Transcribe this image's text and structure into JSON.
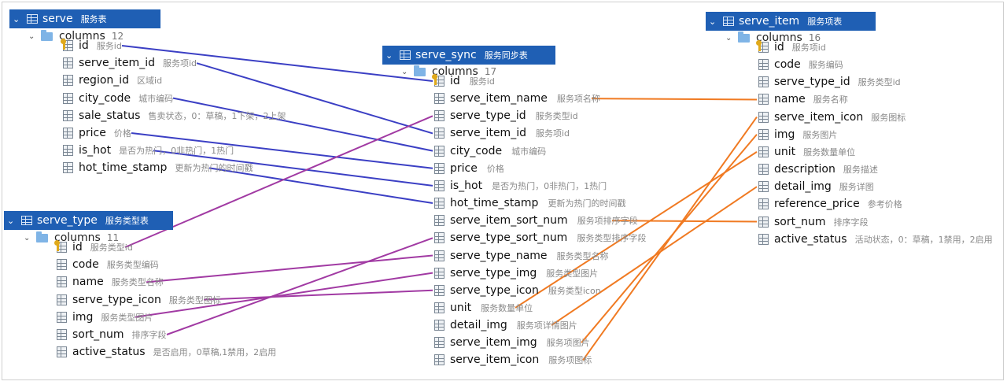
{
  "serve": {
    "name": "serve",
    "comment": "服务表",
    "columns_label": "columns",
    "column_count": "12",
    "fields": [
      {
        "name": "id",
        "comment": "服务id",
        "key": true
      },
      {
        "name": "serve_item_id",
        "comment": "服务项id"
      },
      {
        "name": "region_id",
        "comment": "区域id"
      },
      {
        "name": "city_code",
        "comment": "城市编码"
      },
      {
        "name": "sale_status",
        "comment": "售卖状态，0：草稿，1下架，2上架"
      },
      {
        "name": "price",
        "comment": "价格"
      },
      {
        "name": "is_hot",
        "comment": "是否为热门，0非热门，1热门"
      },
      {
        "name": "hot_time_stamp",
        "comment": "更新为热门的时间戳"
      }
    ]
  },
  "serve_type": {
    "name": "serve_type",
    "comment": "服务类型表",
    "columns_label": "columns",
    "column_count": "11",
    "fields": [
      {
        "name": "id",
        "comment": "服务类型id",
        "key": true
      },
      {
        "name": "code",
        "comment": "服务类型编码"
      },
      {
        "name": "name",
        "comment": "服务类型名称"
      },
      {
        "name": "serve_type_icon",
        "comment": "服务类型图标"
      },
      {
        "name": "img",
        "comment": "服务类型图片"
      },
      {
        "name": "sort_num",
        "comment": "排序字段"
      },
      {
        "name": "active_status",
        "comment": "是否启用，0草稿,1禁用，2启用"
      }
    ]
  },
  "serve_sync": {
    "name": "serve_sync",
    "comment": "服务同步表",
    "columns_label": "columns",
    "column_count": "17",
    "fields": [
      {
        "name": "id",
        "comment": "服务id",
        "key": true
      },
      {
        "name": "serve_item_name",
        "comment": "服务项名称"
      },
      {
        "name": "serve_type_id",
        "comment": "服务类型id"
      },
      {
        "name": "serve_item_id",
        "comment": "服务项id"
      },
      {
        "name": "city_code",
        "comment": "城市编码"
      },
      {
        "name": "price",
        "comment": "价格"
      },
      {
        "name": "is_hot",
        "comment": "是否为热门，0非热门，1热门"
      },
      {
        "name": "hot_time_stamp",
        "comment": "更新为热门的时间戳"
      },
      {
        "name": "serve_item_sort_num",
        "comment": "服务项排序字段"
      },
      {
        "name": "serve_type_sort_num",
        "comment": "服务类型排序字段"
      },
      {
        "name": "serve_type_name",
        "comment": "服务类型名称"
      },
      {
        "name": "serve_type_img",
        "comment": "服务类型图片"
      },
      {
        "name": "serve_type_icon",
        "comment": "服务类型icon"
      },
      {
        "name": "unit",
        "comment": "服务数量单位"
      },
      {
        "name": "detail_img",
        "comment": "服务项详情图片"
      },
      {
        "name": "serve_item_img",
        "comment": "服务项图片"
      },
      {
        "name": "serve_item_icon",
        "comment": "服务项图标"
      }
    ]
  },
  "serve_item": {
    "name": "serve_item",
    "comment": "服务项表",
    "columns_label": "columns",
    "column_count": "16",
    "fields": [
      {
        "name": "id",
        "comment": "服务项id",
        "key": true
      },
      {
        "name": "code",
        "comment": "服务编码"
      },
      {
        "name": "serve_type_id",
        "comment": "服务类型id"
      },
      {
        "name": "name",
        "comment": "服务名称"
      },
      {
        "name": "serve_item_icon",
        "comment": "服务图标"
      },
      {
        "name": "img",
        "comment": "服务图片"
      },
      {
        "name": "unit",
        "comment": "服务数量单位"
      },
      {
        "name": "description",
        "comment": "服务描述"
      },
      {
        "name": "detail_img",
        "comment": "服务详图"
      },
      {
        "name": "reference_price",
        "comment": "参考价格"
      },
      {
        "name": "sort_num",
        "comment": "排序字段"
      },
      {
        "name": "active_status",
        "comment": "活动状态，0：草稿，1禁用，2启用"
      }
    ]
  },
  "colors": {
    "header": "#1f5fb4",
    "serve_links": "#3b3fc4",
    "serve_type_links": "#a13aa3",
    "serve_item_links": "#f07a22"
  },
  "links": [
    {
      "from": "serve.id",
      "to": "serve_sync.id",
      "color": "serve_links"
    },
    {
      "from": "serve.serve_item_id",
      "to": "serve_sync.serve_item_id",
      "color": "serve_links"
    },
    {
      "from": "serve.city_code",
      "to": "serve_sync.city_code",
      "color": "serve_links"
    },
    {
      "from": "serve.price",
      "to": "serve_sync.price",
      "color": "serve_links"
    },
    {
      "from": "serve.is_hot",
      "to": "serve_sync.is_hot",
      "color": "serve_links"
    },
    {
      "from": "serve.hot_time_stamp",
      "to": "serve_sync.hot_time_stamp",
      "color": "serve_links"
    },
    {
      "from": "serve_type.id",
      "to": "serve_sync.serve_type_id",
      "color": "serve_type_links"
    },
    {
      "from": "serve_type.name",
      "to": "serve_sync.serve_type_name",
      "color": "serve_type_links"
    },
    {
      "from": "serve_type.serve_type_icon",
      "to": "serve_sync.serve_type_icon",
      "color": "serve_type_links"
    },
    {
      "from": "serve_type.img",
      "to": "serve_sync.serve_type_img",
      "color": "serve_type_links"
    },
    {
      "from": "serve_type.sort_num",
      "to": "serve_sync.serve_type_sort_num",
      "color": "serve_type_links"
    },
    {
      "from": "serve_sync.serve_item_name",
      "to": "serve_item.name",
      "color": "serve_item_links"
    },
    {
      "from": "serve_sync.serve_item_sort_num",
      "to": "serve_item.sort_num",
      "color": "serve_item_links"
    },
    {
      "from": "serve_sync.unit",
      "to": "serve_item.unit",
      "color": "serve_item_links"
    },
    {
      "from": "serve_sync.detail_img",
      "to": "serve_item.detail_img",
      "color": "serve_item_links"
    },
    {
      "from": "serve_sync.serve_item_img",
      "to": "serve_item.img",
      "color": "serve_item_links"
    },
    {
      "from": "serve_sync.serve_item_icon",
      "to": "serve_item.serve_item_icon",
      "color": "serve_item_links"
    }
  ]
}
